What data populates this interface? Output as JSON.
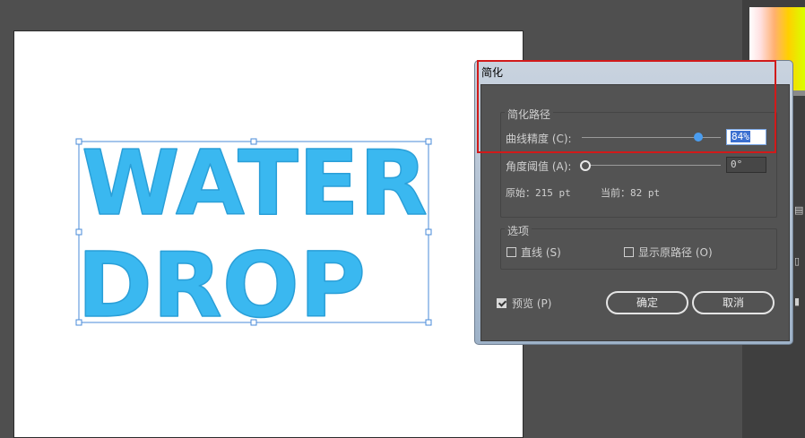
{
  "artwork": {
    "line1": "WATER",
    "line2": "DROP",
    "fill_color": "#3ab8f0",
    "selection_color": "#4a8bd8"
  },
  "dialog": {
    "title": "简化",
    "group_simplify": {
      "legend": "简化路径",
      "curve_precision_label": "曲线精度 (C):",
      "curve_precision_value": "84%",
      "curve_precision_level": 0.84,
      "angle_threshold_label": "角度阈值 (A):",
      "angle_threshold_value": "0°",
      "angle_threshold_level": 0,
      "original_label": "原始：215 pt",
      "current_label": "当前：82 pt"
    },
    "group_options": {
      "legend": "选项",
      "straight_lines_label": "直线 (S)",
      "straight_lines_checked": false,
      "show_original_label": "显示原路径 (O)",
      "show_original_checked": false
    },
    "preview_label": "预览 (P)",
    "preview_checked": true,
    "ok_label": "确定",
    "cancel_label": "取消"
  },
  "colors": {
    "accent_blue": "#4a9df0",
    "highlight_red": "#d11a1a"
  }
}
